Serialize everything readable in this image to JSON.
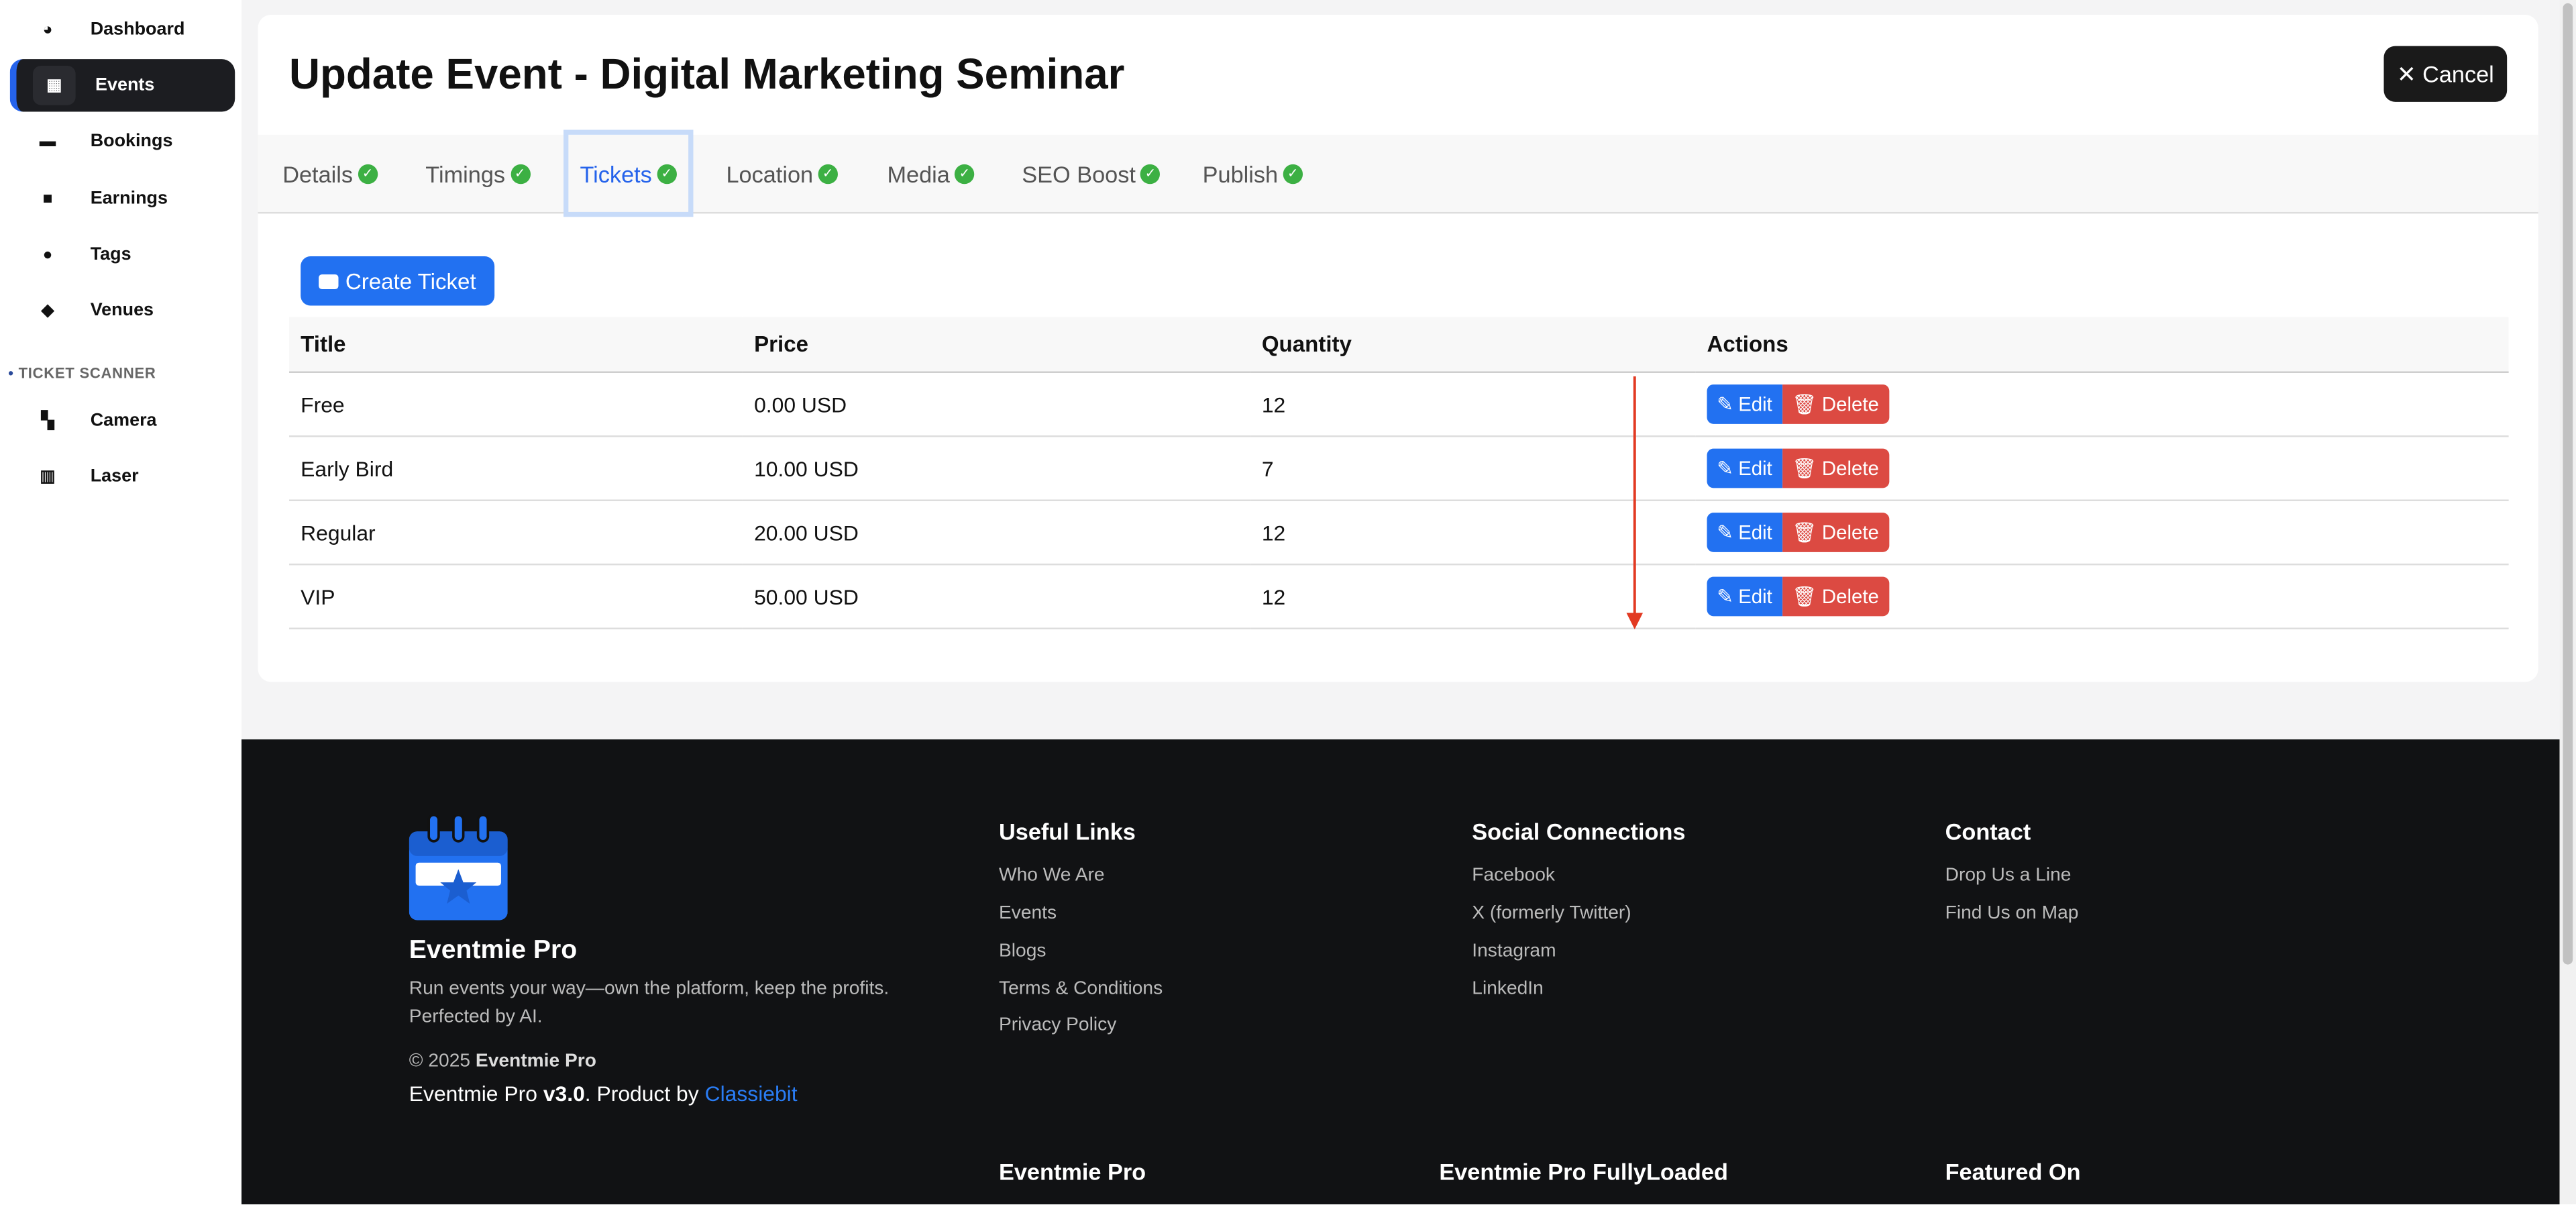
{
  "sidebar": {
    "items": [
      {
        "label": "Dashboard",
        "icon": "gauge-icon"
      },
      {
        "label": "Events",
        "icon": "calendar-icon"
      },
      {
        "label": "Bookings",
        "icon": "money-bill-icon"
      },
      {
        "label": "Earnings",
        "icon": "wallet-icon"
      },
      {
        "label": "Tags",
        "icon": "user-tag-icon"
      },
      {
        "label": "Venues",
        "icon": "map-location-icon"
      }
    ],
    "section": "TICKET SCANNER",
    "scanner_items": [
      {
        "label": "Camera",
        "icon": "qrcode-icon"
      },
      {
        "label": "Laser",
        "icon": "barcode-icon"
      }
    ]
  },
  "header": {
    "title": "Update Event - Digital Marketing Seminar",
    "cancel": "✕ Cancel"
  },
  "tabs": [
    {
      "label": "Details"
    },
    {
      "label": "Timings"
    },
    {
      "label": "Tickets",
      "active": true
    },
    {
      "label": "Location"
    },
    {
      "label": "Media"
    },
    {
      "label": "SEO Boost"
    },
    {
      "label": "Publish"
    }
  ],
  "create_ticket": "Create Ticket",
  "table": {
    "headers": [
      "Title",
      "Price",
      "Quantity",
      "Actions"
    ],
    "rows": [
      [
        "Free",
        "0.00 USD",
        "12"
      ],
      [
        "Early Bird",
        "10.00 USD",
        "7"
      ],
      [
        "Regular",
        "20.00 USD",
        "12"
      ],
      [
        "VIP",
        "50.00 USD",
        "12"
      ]
    ],
    "edit": "Edit",
    "delete": "Delete"
  },
  "footer": {
    "brand": "Eventmie Pro",
    "tagline1": "Run events your way—own the platform, keep the profits.",
    "tagline2": "Perfected by AI.",
    "copyright": "© 2025",
    "copyright_brand": "Eventmie Pro",
    "version_prefix": "Eventmie Pro",
    "version": "v3.0",
    "product_by": ". Product by",
    "company": "Classiebit",
    "useful": {
      "title": "Useful Links",
      "links": [
        "Who We Are",
        "Events",
        "Blogs",
        "Terms & Conditions",
        "Privacy Policy"
      ]
    },
    "social": {
      "title": "Social Connections",
      "links": [
        "Facebook",
        "X (formerly Twitter)",
        "Instagram",
        "LinkedIn"
      ]
    },
    "contact": {
      "title": "Contact",
      "links": [
        "Drop Us a Line",
        "Find Us on Map"
      ]
    },
    "bottom": [
      "Eventmie Pro",
      "Eventmie Pro FullyLoaded",
      "Featured On"
    ]
  },
  "colors": {
    "primary": "#2271f1",
    "danger": "#dc4a42",
    "success": "#3cb043",
    "annotation": "#e23a22"
  }
}
